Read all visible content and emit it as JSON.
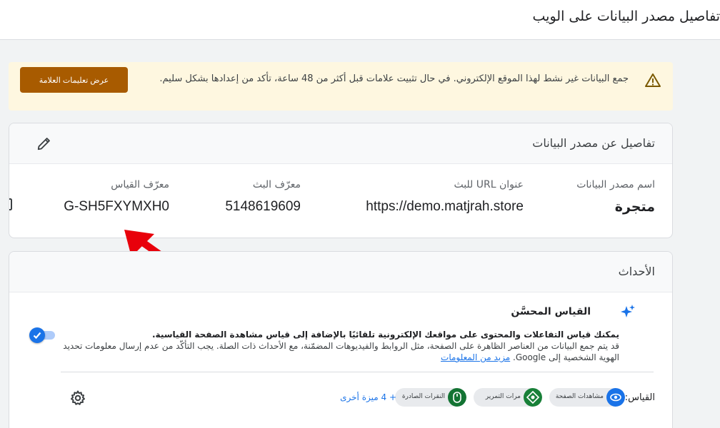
{
  "header": {
    "title": "تفاصيل مصدر البيانات على الويب"
  },
  "banner": {
    "message": "جمع البيانات غير نشط لهذا الموقع الإلكتروني. في حال تثبيت علامات قبل أكثر من 48 ساعة، تأكد من إعدادها بشكل سليم.",
    "button_label": "عرض تعليمات العلامة"
  },
  "stream_details": {
    "heading": "تفاصيل عن مصدر البيانات",
    "fields": [
      {
        "label": "اسم مصدر البيانات",
        "value": "متجرة"
      },
      {
        "label": "عنوان URL للبث",
        "value": "https://demo.matjrah.store"
      },
      {
        "label": "معرّف البث",
        "value": "5148619609"
      },
      {
        "label": "معرّف القياس",
        "value": "G-SH5FXYMXH0"
      }
    ]
  },
  "events": {
    "heading": "الأحداث",
    "enhanced_measurement": {
      "title": "القياس المحسَّن",
      "desc_bold": "يمكنك قياس التفاعلات والمحتوى على مواقعك الإلكترونية تلقائيًا بالإضافة إلى قياس مشاهدة الصفحة القياسية.",
      "desc": "قد يتم جمع البيانات من العناصر الظاهرة على الصفحة، مثل الروابط والفيديوهات المضمّنة، مع الأحداث ذات الصلة. يجب التأكّد من عدم إرسال معلومات تحديد الهوية الشخصية إلى Google.",
      "link": "مزيد من المعلومات",
      "enabled": true
    },
    "measuring_label": "القياس:",
    "chips": [
      {
        "label": "مشاهدات الصفحة",
        "icon": "eye-icon",
        "color": "#1a73e8"
      },
      {
        "label": "مرات التمرير",
        "icon": "scroll-diamond-icon",
        "color": "#188038"
      },
      {
        "label": "النقرات الصادرة",
        "icon": "mouse-icon",
        "color": "#137333"
      }
    ],
    "more_label": "+ 4 ميزة أخرى"
  },
  "colors": {
    "accent": "#1a73e8",
    "warning_bg": "#fef7e0",
    "warning_btn": "#a85b00",
    "annotation_arrow": "#e8000b"
  }
}
